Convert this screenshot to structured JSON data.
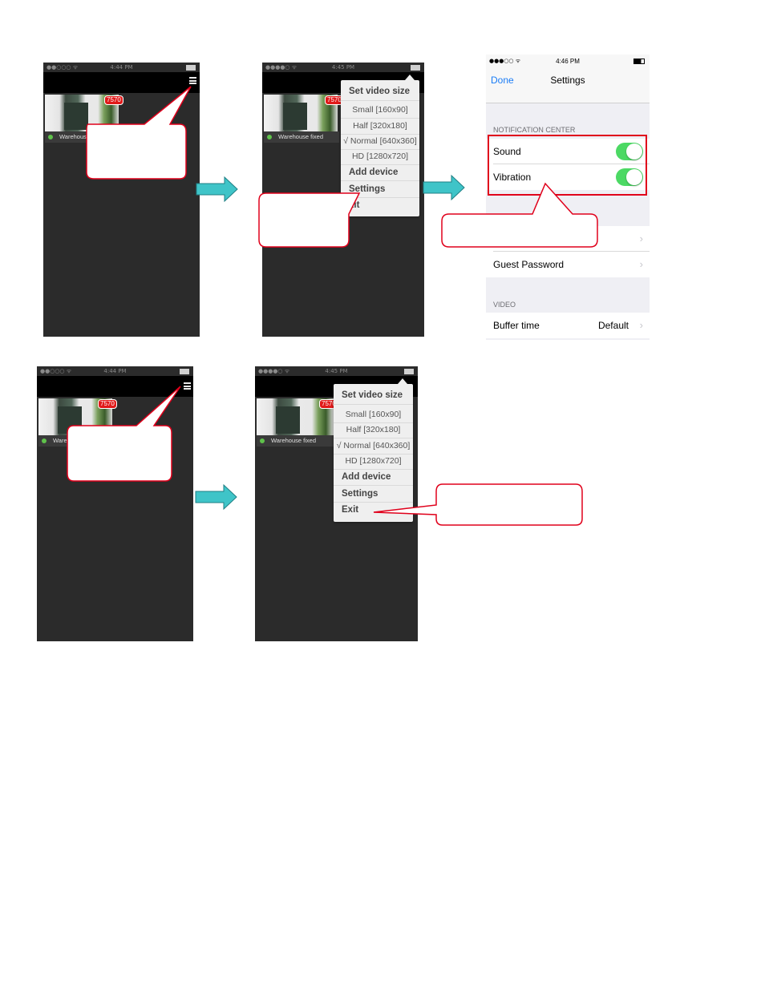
{
  "colors": {
    "phone_bg": "#2b2b2b",
    "callout_border": "#e0001b",
    "arrow": "#3fc4c8",
    "toggle_on": "#4cd964",
    "ios_blue": "#1a7cf6"
  },
  "screen1": {
    "status": {
      "signal": "●●○○○ ᯤ",
      "time": "4:44 PM"
    },
    "badge": "7570",
    "camera_label": "Warehouse fixed",
    "camera_label_visible": "Warehous"
  },
  "screen2": {
    "status": {
      "signal": "●●●●○ ᯤ",
      "time": "4:45 PM"
    },
    "badge": "7570",
    "camera_label": "Warehouse fixed",
    "menu": {
      "header": "Set video size",
      "sizes": [
        "Small [160x90]",
        "Half [320x180]",
        "√ Normal [640x360]",
        "HD [1280x720]"
      ],
      "add_device": "Add device",
      "settings": "Settings",
      "exit": "Exit",
      "exit_visible": "xit"
    }
  },
  "screen3": {
    "status": {
      "signal": "●●●○○ ᯤ",
      "time": "4:46 PM"
    },
    "done": "Done",
    "title": "Settings",
    "section_notification": "NOTIFICATION CENTER",
    "sound": "Sound",
    "vibration": "Vibration",
    "guest_password": "Guest Password",
    "section_video": "VIDEO",
    "buffer_time": "Buffer time",
    "buffer_value": "Default",
    "chevron": "›"
  },
  "screen4": {
    "status": {
      "signal": "●●○○○ ᯤ",
      "time": "4:44 PM"
    },
    "badge": "7570",
    "camera_label_visible": "Ware"
  },
  "screen5": {
    "status": {
      "signal": "●●●●○ ᯤ",
      "time": "4:45 PM"
    },
    "badge": "7570",
    "camera_label": "Warehouse fixed",
    "menu": {
      "header": "Set video size",
      "sizes": [
        "Small [160x90]",
        "Half [320x180]",
        "√ Normal [640x360]",
        "HD [1280x720]"
      ],
      "add_device": "Add device",
      "settings": "Settings",
      "exit": "Exit"
    }
  }
}
